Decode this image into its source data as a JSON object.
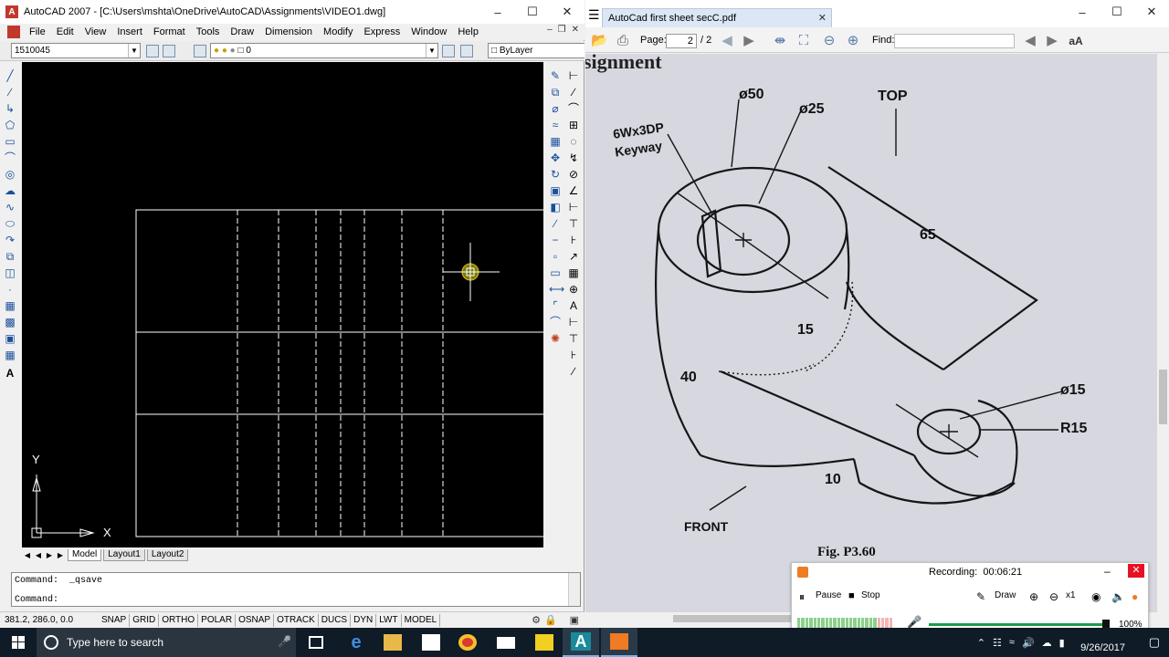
{
  "autocad": {
    "title": "AutoCAD 2007 - [C:\\Users\\mshta\\OneDrive\\AutoCAD\\Assignments\\VIDEO1.dwg]",
    "menu": [
      "File",
      "Edit",
      "View",
      "Insert",
      "Format",
      "Tools",
      "Draw",
      "Dimension",
      "Modify",
      "Express",
      "Window",
      "Help"
    ],
    "toolbar": {
      "workspace_value": "1510045",
      "layer_value": "0",
      "linetype_value": "ByLayer"
    },
    "layout_tabs": [
      "Model",
      "Layout1",
      "Layout2"
    ],
    "ucs": {
      "x_label": "X",
      "y_label": "Y"
    },
    "command_lines": [
      "Command:  _qsave",
      "Command:"
    ],
    "coords": "381.2, 286.0, 0.0",
    "status_buttons": [
      "SNAP",
      "GRID",
      "ORTHO",
      "POLAR",
      "OSNAP",
      "OTRACK",
      "DUCS",
      "DYN",
      "LWT",
      "MODEL"
    ]
  },
  "pdf": {
    "tab_title": "AutoCad first sheet secC.pdf",
    "page_label": "Page:",
    "page_value": "2",
    "page_total": "/ 2",
    "find_label": "Find:",
    "drawing": {
      "labels": {
        "heading": "signment",
        "d50": "ø50",
        "d25": "ø25",
        "top": "TOP",
        "keyway_1": "6Wx3DP",
        "keyway_2": "Keyway",
        "len65": "65",
        "len15": "15",
        "len40": "40",
        "d15": "ø15",
        "r15": "R15",
        "len10": "10",
        "front": "FRONT",
        "fig": "Fig. P3.60"
      }
    }
  },
  "recorder": {
    "label": "Recording:",
    "time": "00:06:21",
    "pause_label": "Pause",
    "stop_label": "Stop",
    "draw_label": "Draw",
    "zoom_label": "x1",
    "volume_pct": "100%",
    "volume_level": 1.0
  },
  "taskbar": {
    "search_placeholder": "Type here to search",
    "date": "9/26/2017"
  },
  "colors": {
    "canvas_bg": "#000000",
    "rec_accent": "#f07b22",
    "close_red": "#e81123",
    "taskbar_bg": "#0f1b26"
  }
}
